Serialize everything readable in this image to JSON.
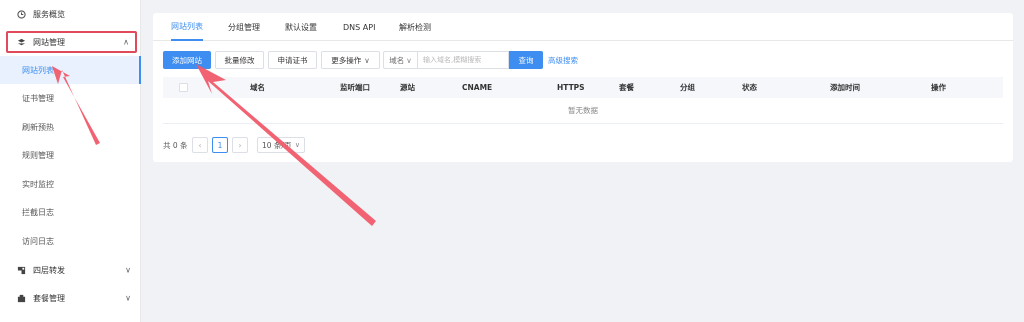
{
  "sidebar": {
    "top_item": {
      "label": "服务概览",
      "icon": "clock-icon"
    },
    "group_site": {
      "label": "网站管理",
      "icon": "globe-icon"
    },
    "sub_items": [
      {
        "label": "网站列表"
      },
      {
        "label": "证书管理"
      },
      {
        "label": "刷新预热"
      },
      {
        "label": "规则管理"
      },
      {
        "label": "实时监控"
      },
      {
        "label": "拦截日志"
      },
      {
        "label": "访问日志"
      }
    ],
    "group_l4": {
      "label": "四层转发",
      "icon": "forward-icon"
    },
    "group_plan": {
      "label": "套餐管理",
      "icon": "package-icon"
    }
  },
  "tabs": [
    {
      "label": "网站列表"
    },
    {
      "label": "分组管理"
    },
    {
      "label": "默认设置"
    },
    {
      "label": "DNS API"
    },
    {
      "label": "解析检测"
    }
  ],
  "toolbar": {
    "add_site": "添加网站",
    "batch_edit": "批量修改",
    "apply_cert": "申请证书",
    "more_ops": "更多操作",
    "search_field": "域名",
    "search_placeholder": "输入域名,模糊搜索",
    "search_button": "查询",
    "advanced_search": "高级搜索"
  },
  "table": {
    "columns": [
      "域名",
      "监听端口",
      "源站",
      "CNAME",
      "HTTPS",
      "套餐",
      "分组",
      "状态",
      "添加时间",
      "操作"
    ],
    "empty_text": "暂无数据"
  },
  "pagination": {
    "total_text": "共 0 条",
    "current_page": "1",
    "page_size": "10 条/页"
  },
  "colors": {
    "accent": "#3d8ef0",
    "highlight": "#e04a5a"
  }
}
